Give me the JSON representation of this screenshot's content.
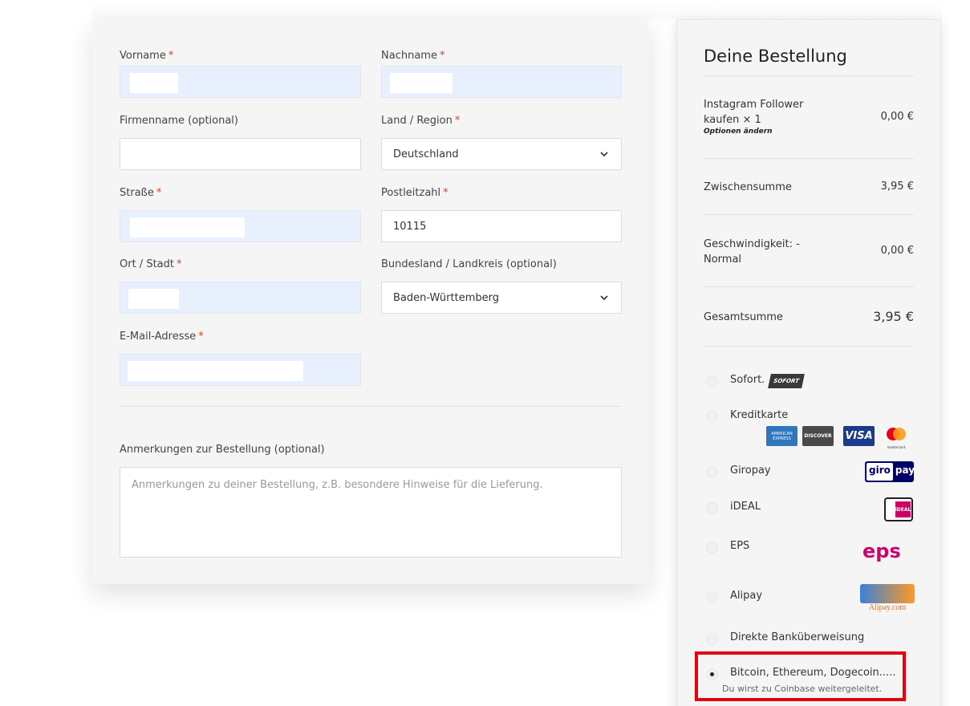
{
  "form": {
    "first_name": {
      "label": "Vorname",
      "required": "*",
      "value": ""
    },
    "last_name": {
      "label": "Nachname",
      "required": "*",
      "value": ""
    },
    "company": {
      "label": "Firmenname (optional)",
      "value": ""
    },
    "country": {
      "label": "Land / Region",
      "required": "*",
      "value": "Deutschland"
    },
    "street": {
      "label": "Straße",
      "required": "*",
      "value": ""
    },
    "postcode": {
      "label": "Postleitzahl",
      "required": "*",
      "value": "10115"
    },
    "city": {
      "label": "Ort / Stadt",
      "required": "*",
      "value": ""
    },
    "state": {
      "label": "Bundesland / Landkreis (optional)",
      "value": "Baden-Württemberg"
    },
    "email": {
      "label": "E-Mail-Adresse",
      "required": "*",
      "value": ""
    },
    "notes": {
      "label": "Anmerkungen zur Bestellung (optional)",
      "placeholder": "Anmerkungen zu deiner Bestellung, z.B. besondere Hinweise für die Lieferung."
    }
  },
  "order": {
    "title": "Deine Bestellung",
    "item": {
      "name_line1": "Instagram Follower",
      "name_line2": "kaufen × 1",
      "options_link": "Optionen ändern",
      "price": "0,00 €"
    },
    "subtotal": {
      "label": "Zwischensumme",
      "value": "3,95 €"
    },
    "speed": {
      "label_line1": "Geschwindigkeit: -",
      "label_line2": "Normal",
      "value": "0,00 €"
    },
    "total": {
      "label": "Gesamtsumme",
      "value": "3,95 €"
    }
  },
  "payment": {
    "methods": [
      {
        "label": "Sofort.",
        "logo": "sofort-logo",
        "logo_text": "SOFORT"
      },
      {
        "label": "Kreditkarte",
        "logos": [
          "amex-logo",
          "discover-logo",
          "visa-logo",
          "mastercard-logo"
        ]
      },
      {
        "label": "Giropay",
        "logo": "giropay-logo",
        "logo_text_1": "giro",
        "logo_text_2": "pay"
      },
      {
        "label": "iDEAL",
        "logo": "ideal-logo",
        "logo_text": "iDEAL"
      },
      {
        "label": "EPS",
        "logo": "eps-logo",
        "logo_text": "eps"
      },
      {
        "label": "Alipay",
        "logo": "alipay-logo",
        "logo_text": "Alipay.com"
      },
      {
        "label": "Direkte Banküberweisung"
      },
      {
        "label": "Bitcoin, Ethereum, Dogecoin.....",
        "selected": true,
        "description": "Du wirst zu Coinbase weitergeleitet."
      }
    ],
    "card_logo_text": {
      "amex": "AMERICAN EXPRESS",
      "discover": "DISCOVER",
      "visa": "VISA",
      "mastercard": "mastercard"
    }
  },
  "colors": {
    "required_star": "#e2401c",
    "autofill_bg": "#e8f0fe",
    "highlight": "#e4000f"
  }
}
